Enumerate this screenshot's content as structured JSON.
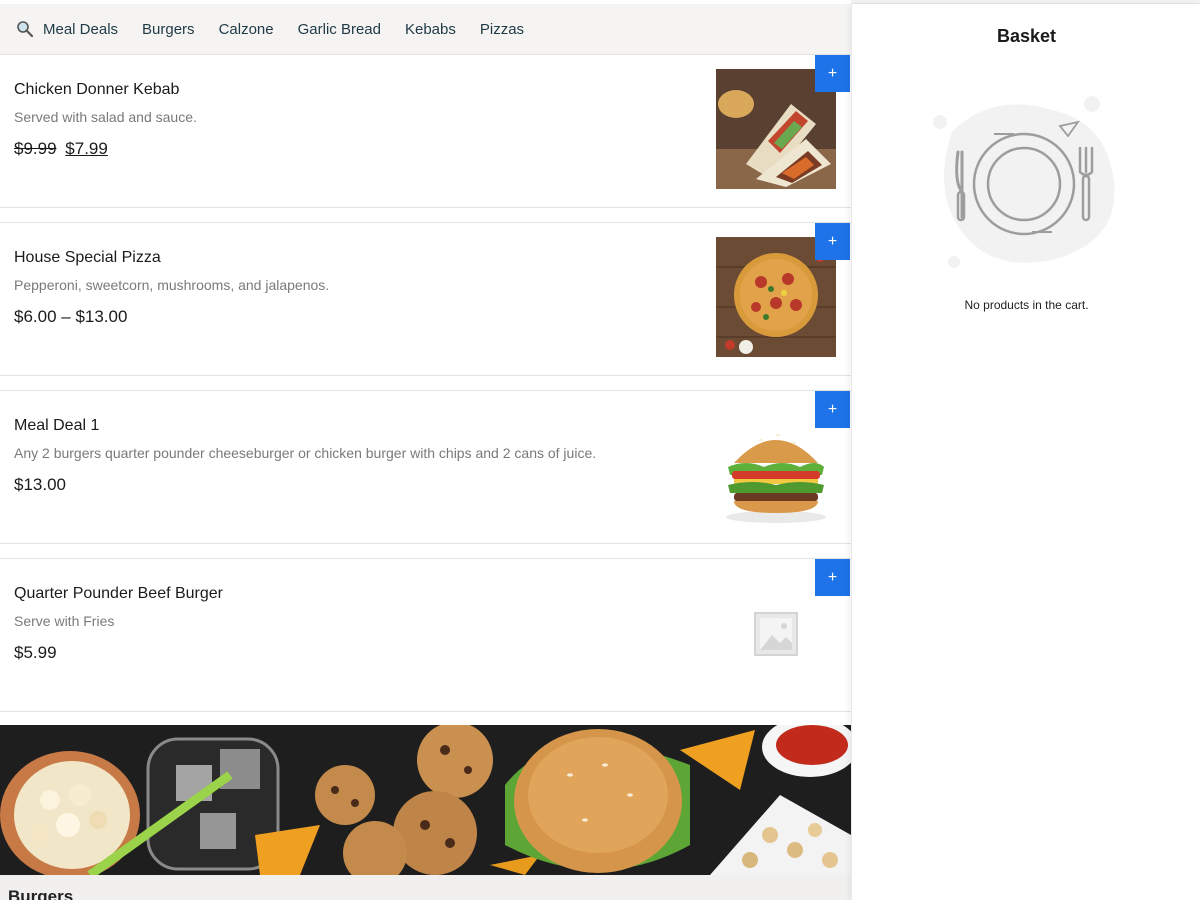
{
  "nav": {
    "categories": [
      "Meal Deals",
      "Burgers",
      "Calzone",
      "Garlic Bread",
      "Kebabs",
      "Pizzas"
    ]
  },
  "items": [
    {
      "title": "Chicken Donner Kebab",
      "description": "Served with salad and sauce.",
      "price_old": "$9.99",
      "price_new": "$7.99",
      "add": "+",
      "image": "kebab-wrap-photo"
    },
    {
      "title": "House Special Pizza",
      "description": "Pepperoni, sweetcorn, mushrooms, and jalapenos.",
      "price": "$6.00 – $13.00",
      "add": "+",
      "image": "pizza-photo"
    },
    {
      "title": "Meal Deal 1",
      "description": "Any 2 burgers quarter pounder cheeseburger or chicken burger with chips and 2 cans of juice.",
      "price": "$13.00",
      "add": "+",
      "image": "burger-photo"
    },
    {
      "title": "Quarter Pounder Beef Burger",
      "description": "Serve with Fries",
      "price": "$5.99",
      "add": "+",
      "image": "placeholder-image-icon"
    }
  ],
  "section": {
    "title": "Burgers"
  },
  "basket": {
    "title": "Basket",
    "empty_message": "No products in the cart."
  },
  "colors": {
    "accent": "#1e73e8",
    "nav_bg": "#f5f4f2",
    "nav_text": "#1f3a46"
  }
}
